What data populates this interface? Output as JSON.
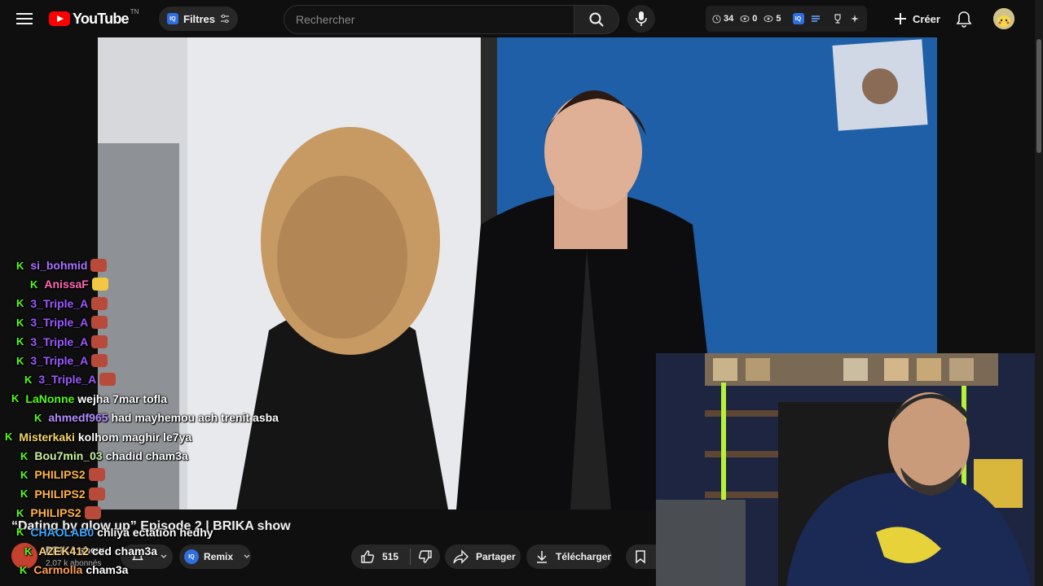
{
  "header": {
    "logo_text": "YouTube",
    "logo_tm": "TN",
    "filters_label": "Filtres",
    "search_placeholder": "Rechercher",
    "stats": [
      {
        "icon": "clock-icon",
        "value": "34"
      },
      {
        "icon": "eye-icon",
        "value": "0"
      },
      {
        "icon": "eye-icon",
        "value": "5"
      }
    ],
    "create_label": "Créer"
  },
  "video": {
    "title": "“Dating by glow up” Episode 2 | BRIKA show",
    "channel_name": "BRIKA show",
    "subscribers": "2,07 k abonnés",
    "remix_label": "Remix",
    "likes": "515",
    "share_label": "Partager",
    "download_label": "Télécharger"
  },
  "chat": [
    {
      "user": "si_bohmid",
      "color": "#a970ff",
      "text": "",
      "emote": true
    },
    {
      "user": "AnissaF",
      "color": "#ff69b4",
      "text": "",
      "emote": true
    },
    {
      "user": "3_Triple_A",
      "color": "#9b59ff",
      "text": "",
      "emote": true
    },
    {
      "user": "3_Triple_A",
      "color": "#9b59ff",
      "text": "",
      "emote": true
    },
    {
      "user": "3_Triple_A",
      "color": "#9b59ff",
      "text": "",
      "emote": true
    },
    {
      "user": "3_Triple_A",
      "color": "#9b59ff",
      "text": "",
      "emote": true
    },
    {
      "user": "3_Triple_A",
      "color": "#9b59ff",
      "text": "",
      "emote": true
    },
    {
      "user": "LaNonne",
      "color": "#53fc18",
      "text": "wejha 7mar tofla",
      "emote": false
    },
    {
      "user": "ahmedf965",
      "color": "#b38cff",
      "text": "had mayhemou ach trenit asba",
      "emote": false
    },
    {
      "user": "Misterkaki",
      "color": "#f5d36a",
      "text": "kolhom maghir le7ya",
      "emote": false
    },
    {
      "user": "Bou7min_03",
      "color": "#c9f0a0",
      "text": "chadid cham3a",
      "emote": false
    },
    {
      "user": "PHILIPS2",
      "color": "#ffb347",
      "text": "",
      "emote": true
    },
    {
      "user": "PHILIPS2",
      "color": "#ffb347",
      "text": "",
      "emote": true
    },
    {
      "user": "PHILIPS2",
      "color": "#ffb347",
      "text": "",
      "emote": true
    },
    {
      "user": "CHAOLAB0",
      "color": "#3ea6ff",
      "text": "chliya ectation hedhy",
      "emote": false
    },
    {
      "user": "AZEK412",
      "color": "#ffd27f",
      "text": "ced cham3a",
      "emote": false
    },
    {
      "user": "Carmolla",
      "color": "#ff9e57",
      "text": "cham3a",
      "emote": false
    }
  ],
  "colors": {
    "background": "#0f0f0f",
    "accent_red": "#ff0000",
    "kick_green": "#53fc18"
  }
}
